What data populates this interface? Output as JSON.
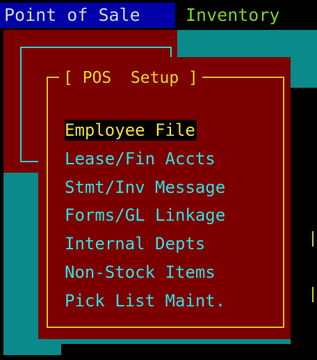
{
  "menubar": {
    "items": [
      {
        "label": "Point of Sale"
      },
      {
        "label": "Inventory"
      }
    ]
  },
  "dialog": {
    "title": "[ POS  Setup ]",
    "options": [
      {
        "label": "Employee File",
        "selected": true
      },
      {
        "label": "Lease/Fin Accts",
        "selected": false
      },
      {
        "label": "Stmt/Inv Message",
        "selected": false
      },
      {
        "label": "Forms/GL Linkage",
        "selected": false
      },
      {
        "label": "Internal Depts",
        "selected": false
      },
      {
        "label": "Non-Stock Items",
        "selected": false
      },
      {
        "label": "Pick List Maint.",
        "selected": false
      }
    ]
  },
  "colors": {
    "menubar_active_bg": "#0000aa",
    "menu_inventory_fg": "#7fcf2a",
    "desktop_teal": "#0a8a8a",
    "window_red": "#7c0000",
    "frame_yellow": "#d6c520",
    "frame_cyan": "#2bd0d0",
    "option_text": "#2ee2e2",
    "selected_bg": "#000000",
    "selected_fg": "#f0e040"
  }
}
